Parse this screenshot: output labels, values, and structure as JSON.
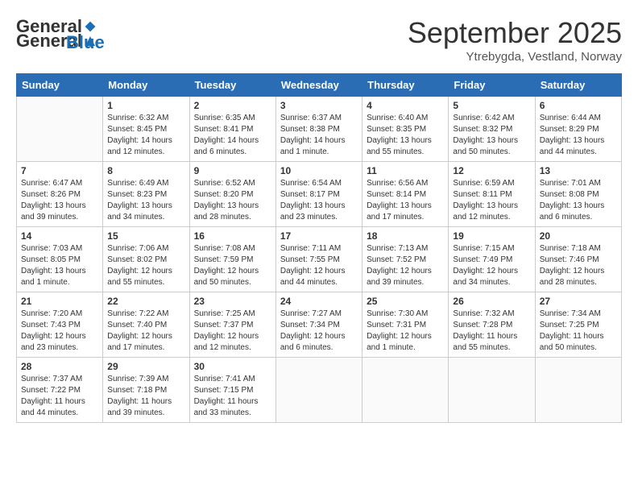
{
  "header": {
    "logo": {
      "general": "General",
      "blue": "Blue"
    },
    "title": "September 2025",
    "subtitle": "Ytrebygda, Vestland, Norway"
  },
  "days_of_week": [
    "Sunday",
    "Monday",
    "Tuesday",
    "Wednesday",
    "Thursday",
    "Friday",
    "Saturday"
  ],
  "weeks": [
    [
      {
        "day": null
      },
      {
        "day": 1,
        "sunrise": "6:32 AM",
        "sunset": "8:45 PM",
        "daylight": "14 hours and 12 minutes."
      },
      {
        "day": 2,
        "sunrise": "6:35 AM",
        "sunset": "8:41 PM",
        "daylight": "14 hours and 6 minutes."
      },
      {
        "day": 3,
        "sunrise": "6:37 AM",
        "sunset": "8:38 PM",
        "daylight": "14 hours and 1 minute."
      },
      {
        "day": 4,
        "sunrise": "6:40 AM",
        "sunset": "8:35 PM",
        "daylight": "13 hours and 55 minutes."
      },
      {
        "day": 5,
        "sunrise": "6:42 AM",
        "sunset": "8:32 PM",
        "daylight": "13 hours and 50 minutes."
      },
      {
        "day": 6,
        "sunrise": "6:44 AM",
        "sunset": "8:29 PM",
        "daylight": "13 hours and 44 minutes."
      }
    ],
    [
      {
        "day": 7,
        "sunrise": "6:47 AM",
        "sunset": "8:26 PM",
        "daylight": "13 hours and 39 minutes."
      },
      {
        "day": 8,
        "sunrise": "6:49 AM",
        "sunset": "8:23 PM",
        "daylight": "13 hours and 34 minutes."
      },
      {
        "day": 9,
        "sunrise": "6:52 AM",
        "sunset": "8:20 PM",
        "daylight": "13 hours and 28 minutes."
      },
      {
        "day": 10,
        "sunrise": "6:54 AM",
        "sunset": "8:17 PM",
        "daylight": "13 hours and 23 minutes."
      },
      {
        "day": 11,
        "sunrise": "6:56 AM",
        "sunset": "8:14 PM",
        "daylight": "13 hours and 17 minutes."
      },
      {
        "day": 12,
        "sunrise": "6:59 AM",
        "sunset": "8:11 PM",
        "daylight": "13 hours and 12 minutes."
      },
      {
        "day": 13,
        "sunrise": "7:01 AM",
        "sunset": "8:08 PM",
        "daylight": "13 hours and 6 minutes."
      }
    ],
    [
      {
        "day": 14,
        "sunrise": "7:03 AM",
        "sunset": "8:05 PM",
        "daylight": "13 hours and 1 minute."
      },
      {
        "day": 15,
        "sunrise": "7:06 AM",
        "sunset": "8:02 PM",
        "daylight": "12 hours and 55 minutes."
      },
      {
        "day": 16,
        "sunrise": "7:08 AM",
        "sunset": "7:59 PM",
        "daylight": "12 hours and 50 minutes."
      },
      {
        "day": 17,
        "sunrise": "7:11 AM",
        "sunset": "7:55 PM",
        "daylight": "12 hours and 44 minutes."
      },
      {
        "day": 18,
        "sunrise": "7:13 AM",
        "sunset": "7:52 PM",
        "daylight": "12 hours and 39 minutes."
      },
      {
        "day": 19,
        "sunrise": "7:15 AM",
        "sunset": "7:49 PM",
        "daylight": "12 hours and 34 minutes."
      },
      {
        "day": 20,
        "sunrise": "7:18 AM",
        "sunset": "7:46 PM",
        "daylight": "12 hours and 28 minutes."
      }
    ],
    [
      {
        "day": 21,
        "sunrise": "7:20 AM",
        "sunset": "7:43 PM",
        "daylight": "12 hours and 23 minutes."
      },
      {
        "day": 22,
        "sunrise": "7:22 AM",
        "sunset": "7:40 PM",
        "daylight": "12 hours and 17 minutes."
      },
      {
        "day": 23,
        "sunrise": "7:25 AM",
        "sunset": "7:37 PM",
        "daylight": "12 hours and 12 minutes."
      },
      {
        "day": 24,
        "sunrise": "7:27 AM",
        "sunset": "7:34 PM",
        "daylight": "12 hours and 6 minutes."
      },
      {
        "day": 25,
        "sunrise": "7:30 AM",
        "sunset": "7:31 PM",
        "daylight": "12 hours and 1 minute."
      },
      {
        "day": 26,
        "sunrise": "7:32 AM",
        "sunset": "7:28 PM",
        "daylight": "11 hours and 55 minutes."
      },
      {
        "day": 27,
        "sunrise": "7:34 AM",
        "sunset": "7:25 PM",
        "daylight": "11 hours and 50 minutes."
      }
    ],
    [
      {
        "day": 28,
        "sunrise": "7:37 AM",
        "sunset": "7:22 PM",
        "daylight": "11 hours and 44 minutes."
      },
      {
        "day": 29,
        "sunrise": "7:39 AM",
        "sunset": "7:18 PM",
        "daylight": "11 hours and 39 minutes."
      },
      {
        "day": 30,
        "sunrise": "7:41 AM",
        "sunset": "7:15 PM",
        "daylight": "11 hours and 33 minutes."
      },
      {
        "day": null
      },
      {
        "day": null
      },
      {
        "day": null
      },
      {
        "day": null
      }
    ]
  ]
}
